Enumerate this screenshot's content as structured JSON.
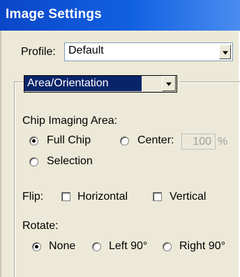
{
  "window": {
    "title": "Image Settings"
  },
  "profile": {
    "label": "Profile:",
    "value": "Default"
  },
  "section_select": {
    "value": "Area/Orientation"
  },
  "chip_area": {
    "label": "Chip Imaging Area:",
    "full_chip": "Full Chip",
    "center": "Center:",
    "center_value": "100",
    "percent": "%",
    "selection": "Selection",
    "selected": "full_chip"
  },
  "flip": {
    "label": "Flip:",
    "horizontal": "Horizontal",
    "vertical": "Vertical"
  },
  "rotate": {
    "label": "Rotate:",
    "none": "None",
    "left": "Left 90°",
    "right": "Right 90°",
    "selected": "none"
  },
  "icons": [
    "chevron-down-icon"
  ]
}
